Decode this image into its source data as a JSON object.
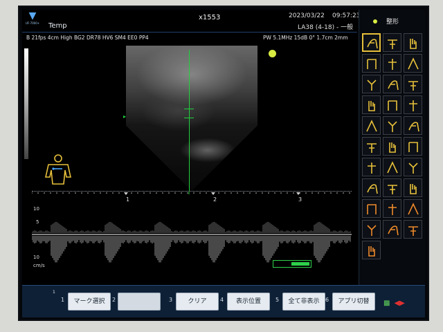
{
  "header": {
    "logo_text": "UF-7000+",
    "app_label": "Temp",
    "center_id": "x1553",
    "date": "2023/03/22",
    "time": "09:57:23",
    "probe_label": "LA38 (4-18) - 一般",
    "bmode_params": "B  21fps  4cm  High  BG2  DR78  HV6  SM4  EE0  PP4",
    "pw_params": "PW  5.1MHz  15dB  0°   1.7cm   2mm"
  },
  "doppler": {
    "time_marks": [
      "1",
      "2",
      "3"
    ],
    "scale_top": "10",
    "scale_top_minor": "5",
    "scale_bottom": "10",
    "unit": "cm/s"
  },
  "side_panel": {
    "title": "整形",
    "selected_index": 0,
    "icon_names": [
      "bodymark-shoulder-icon",
      "bodymark-shoulder-arm-icon",
      "bodymark-hand-icon",
      "bodymark-shoulder-front-icon",
      "bodymark-shoulder-back-icon",
      "bodymark-arm-icon",
      "bodymark-elbow-icon",
      "bodymark-forearm-icon",
      "bodymark-wrist-icon",
      "bodymark-elbow-bent-icon",
      "bodymark-forearm-side-icon",
      "bodymark-hand-side-icon",
      "bodymark-hip-icon",
      "bodymark-thigh-icon",
      "bodymark-knee-icon",
      "bodymark-knee-front-icon",
      "bodymark-leg-icon",
      "bodymark-ankle-icon",
      "bodymark-foot-icon",
      "bodymark-foot-side-icon",
      "bodymark-heel-icon",
      "bodymark-foot-sole-icon",
      "bodymark-foot-top-icon",
      "bodymark-toes-icon",
      "bodymark-hand-palm-icon",
      "bodymark-hand-back-icon",
      "bodymark-fingers-icon",
      "bodymark-hand-open-icon",
      "bodymark-hand-grip-icon",
      "bodymark-hand-spread-icon",
      "bodymark-foot-toes-icon"
    ]
  },
  "softkeys": {
    "n1": "1",
    "n1_small": "1",
    "k1": "マーク選択",
    "n2": "2",
    "k2": "",
    "n3": "3",
    "k3": "クリア",
    "n4": "4",
    "k4": "表示位置",
    "n5": "5",
    "k5": "全て非表示",
    "n6": "6",
    "k6": "アプリ切替"
  },
  "colors": {
    "accent_green": "#1fd23c",
    "marker_yellow": "#d8ec42",
    "bodymark_gold": "#e8c13b",
    "softkey_bar": "#0e2036"
  }
}
